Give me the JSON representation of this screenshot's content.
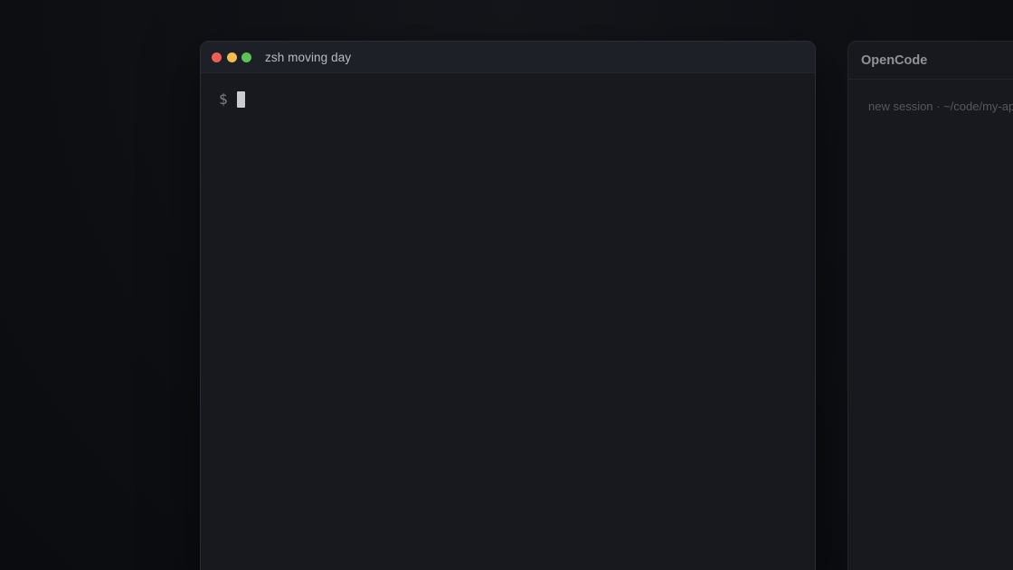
{
  "terminal": {
    "title": "zsh moving day",
    "prompt": "$"
  },
  "opencode": {
    "title": "OpenCode",
    "session_text": "new session · ~/code/my-app"
  },
  "colors": {
    "close": "#ee5e55",
    "minimize": "#f4bd4f",
    "maximize": "#5dc356",
    "background": "#0e1014",
    "window": "#17191e"
  }
}
